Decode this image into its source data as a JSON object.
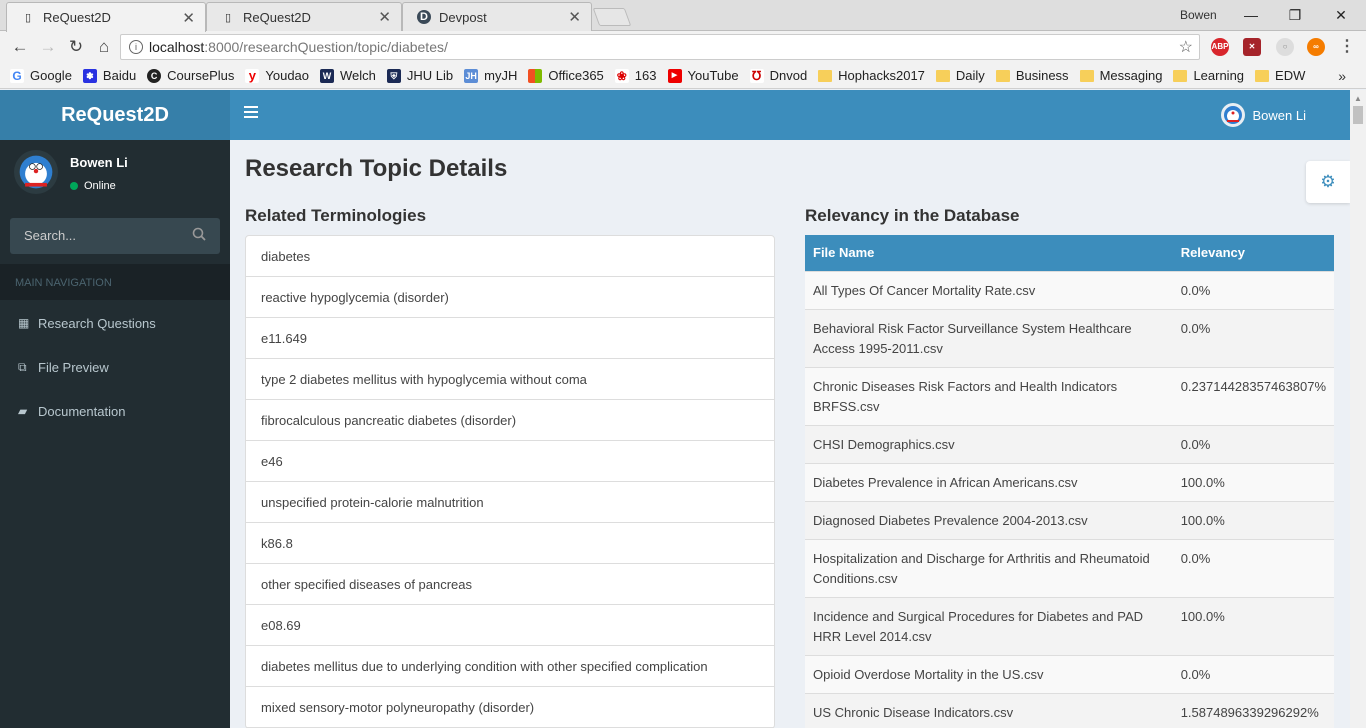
{
  "browser": {
    "tabs": [
      {
        "title": "ReQuest2D",
        "active": true
      },
      {
        "title": "ReQuest2D",
        "active": false
      },
      {
        "title": "Devpost",
        "active": false
      }
    ],
    "window_user": "Bowen",
    "url_host": "localhost",
    "url_path": ":8000/researchQuestion/topic/diabetes/",
    "bookmarks": [
      "Google",
      "Baidu",
      "CoursePlus",
      "Youdao",
      "Welch",
      "JHU Lib",
      "myJH",
      "Office365",
      "163",
      "YouTube",
      "Dnvod",
      "Hophacks2017",
      "Daily",
      "Business",
      "Messaging",
      "Learning",
      "EDW"
    ],
    "bookmarks_more": "»",
    "extensions": {
      "abp": "ABP"
    }
  },
  "app": {
    "logo": "ReQuest2D",
    "user_name": "Bowen Li",
    "status": "Online",
    "search_placeholder": "Search...",
    "nav_header": "MAIN NAVIGATION",
    "nav": [
      "Research Questions",
      "File Preview",
      "Documentation"
    ]
  },
  "content": {
    "title": "Research Topic Details",
    "terms_heading": "Related Terminologies",
    "terms": [
      "diabetes",
      "reactive hypoglycemia (disorder)",
      "e11.649",
      "type 2 diabetes mellitus with hypoglycemia without coma",
      "fibrocalculous pancreatic diabetes (disorder)",
      "e46",
      "unspecified protein-calorie malnutrition",
      "k86.8",
      "other specified diseases of pancreas",
      "e08.69",
      "diabetes mellitus due to underlying condition with other specified complication",
      "mixed sensory-motor polyneuropathy (disorder)"
    ],
    "relevancy_heading": "Relevancy in the Database",
    "table_headers": [
      "File Name",
      "Relevancy"
    ],
    "rows": [
      [
        "All Types Of Cancer Mortality Rate.csv",
        "0.0%"
      ],
      [
        "Behavioral Risk Factor Surveillance System Healthcare Access 1995-2011.csv",
        "0.0%"
      ],
      [
        "Chronic Diseases Risk Factors and Health Indicators BRFSS.csv",
        "0.23714428357463807%"
      ],
      [
        "CHSI Demographics.csv",
        "0.0%"
      ],
      [
        "Diabetes Prevalence in African Americans.csv",
        "100.0%"
      ],
      [
        "Diagnosed Diabetes Prevalence 2004-2013.csv",
        "100.0%"
      ],
      [
        "Hospitalization and Discharge for Arthritis and Rheumatoid Conditions.csv",
        "0.0%"
      ],
      [
        "Incidence and Surgical Procedures for Diabetes and PAD HRR Level 2014.csv",
        "100.0%"
      ],
      [
        "Opioid Overdose Mortality in the US.csv",
        "0.0%"
      ],
      [
        "US Chronic Disease Indicators.csv",
        "1.5874896339296292%"
      ]
    ]
  }
}
